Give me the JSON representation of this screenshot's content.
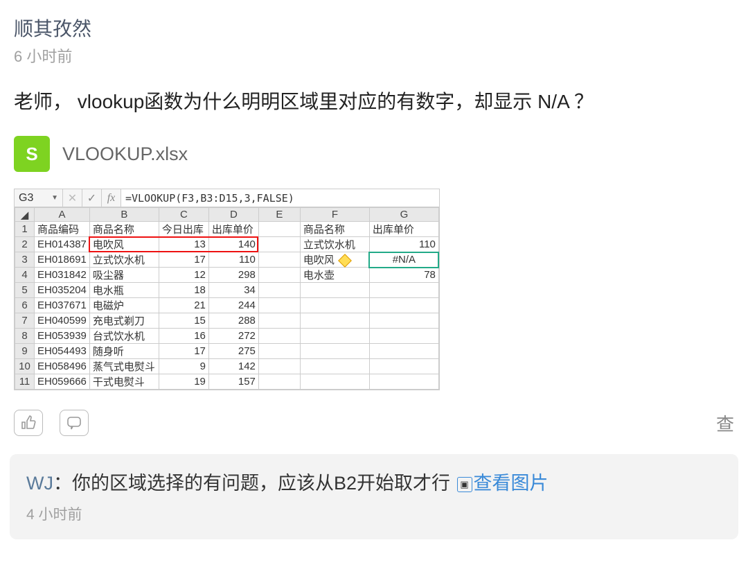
{
  "post": {
    "author": "顺其孜然",
    "timestamp": "6 小时前",
    "question": "老师， vlookup函数为什么明明区域里对应的有数字，却显示 N/A ？"
  },
  "attachment": {
    "icon_letter": "S",
    "filename": "VLOOKUP.xlsx"
  },
  "formula_bar": {
    "cell_ref": "G3",
    "formula": "=VLOOKUP(F3,B3:D15,3,FALSE)"
  },
  "sheet": {
    "columns": [
      "A",
      "B",
      "C",
      "D",
      "E",
      "F",
      "G"
    ],
    "headers_row1": {
      "A": "商品编码",
      "B": "商品名称",
      "C": "今日出库",
      "D": "出库单价",
      "F": "商品名称",
      "G": "出库单价"
    },
    "data_left": [
      {
        "A": "EH014387",
        "B": "电吹风",
        "C": 13,
        "D": 140
      },
      {
        "A": "EH018691",
        "B": "立式饮水机",
        "C": 17,
        "D": 110
      },
      {
        "A": "EH031842",
        "B": "吸尘器",
        "C": 12,
        "D": 298
      },
      {
        "A": "EH035204",
        "B": "电水瓶",
        "C": 18,
        "D": 34
      },
      {
        "A": "EH037671",
        "B": "电磁炉",
        "C": 21,
        "D": 244
      },
      {
        "A": "EH040599",
        "B": "充电式剃刀",
        "C": 15,
        "D": 288
      },
      {
        "A": "EH053939",
        "B": "台式饮水机",
        "C": 16,
        "D": 272
      },
      {
        "A": "EH054493",
        "B": "随身听",
        "C": 17,
        "D": 275
      },
      {
        "A": "EH058496",
        "B": "蒸气式电熨斗",
        "C": 9,
        "D": 142
      },
      {
        "A": "EH059666",
        "B": "干式电熨斗",
        "C": 19,
        "D": 157
      }
    ],
    "data_right": [
      {
        "F": "立式饮水机",
        "G": "110"
      },
      {
        "F": "电吹风",
        "G": "#N/A",
        "warn": true,
        "active": true
      },
      {
        "F": "电水壶",
        "G": "78"
      }
    ]
  },
  "actions": {
    "view_text": "查"
  },
  "reply": {
    "author": "WJ",
    "sep": "：",
    "text": "你的区域选择的有问题，应该从B2开始取才行",
    "link": "查看图片",
    "timestamp": "4 小时前"
  }
}
